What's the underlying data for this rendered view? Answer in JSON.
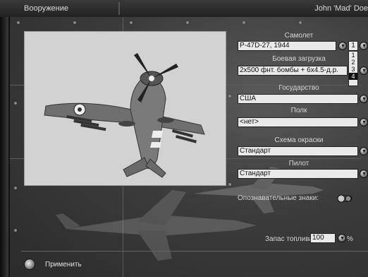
{
  "titlebar": {
    "left_title": "Вооружение",
    "right_title": "John 'Mad' Doe"
  },
  "aircraft": {
    "label": "Самолет",
    "value": "P-47D-27, 1944",
    "count_value": "1",
    "count_options": [
      "1",
      "2",
      "3",
      "4"
    ],
    "count_highlighted": "4"
  },
  "loadout": {
    "label": "Боевая загрузка",
    "value": "2x500 фнт. бомбы + 6x4.5-д.р."
  },
  "country": {
    "label": "Государство",
    "value": "США"
  },
  "regiment": {
    "label": "Полк",
    "value": "<нет>"
  },
  "paint_scheme": {
    "label": "Схема окраски",
    "value": "Стандарт"
  },
  "pilot": {
    "label": "Пилот",
    "value": "Стандарт"
  },
  "insignia": {
    "label": "Опознавательные знаки:"
  },
  "fuel": {
    "label": "Запас топлива",
    "value": "100",
    "unit": "%"
  },
  "apply": {
    "label": "Применить"
  },
  "icons": {
    "dropdown": "chevron-down-icon",
    "apply": "globe-icon",
    "toggle": "toggle-icon"
  },
  "colors": {
    "panel": "#3c3c3c",
    "field_bg": "#e9e9e9",
    "preview_bg": "#d2d2d2",
    "text_light": "#d6d6d6"
  }
}
